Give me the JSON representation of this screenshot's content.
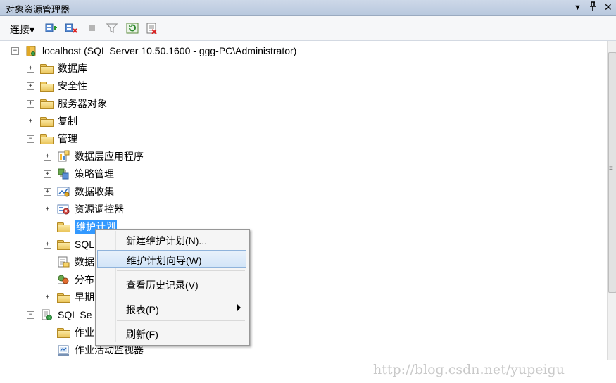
{
  "window": {
    "title": "对象资源管理器",
    "dropdown_glyph": "▼",
    "pin_glyph": "ꟷ",
    "close_glyph": "✕"
  },
  "toolbar": {
    "connect_label": "连接",
    "connect_arrow": "▾",
    "icons": [
      "connect-object-icon",
      "disconnect-icon",
      "stop-icon",
      "filter-icon",
      "refresh-icon",
      "summary-icon"
    ]
  },
  "tree": {
    "server": "localhost (SQL Server 10.50.1600 - ggg-PC\\Administrator)",
    "databases": "数据库",
    "security": "安全性",
    "server_objects": "服务器对象",
    "replication": "复制",
    "management": "管理",
    "data_tier_apps": "数据层应用程序",
    "policy_management": "策略管理",
    "data_collection": "数据收集",
    "resource_governor": "资源调控器",
    "maintenance_plans": "维护计划",
    "sql_server_logs": "SQL",
    "database_mail": "数据",
    "dtc": "分布",
    "legacy": "早期",
    "sql_agent": "SQL Se",
    "jobs": "作业",
    "job_activity_monitor": "作业活动监视器",
    "expand_glyph": "+",
    "collapse_glyph": "−"
  },
  "context_menu": {
    "new_plan": "新建维护计划(N)...",
    "wizard": "维护计划向导(W)",
    "view_history": "查看历史记录(V)",
    "reports": "报表(P)",
    "refresh": "刷新(F)"
  },
  "scrollbar": {
    "grip": "≡"
  },
  "watermark": "http://blog.csdn.net/yupeigu"
}
